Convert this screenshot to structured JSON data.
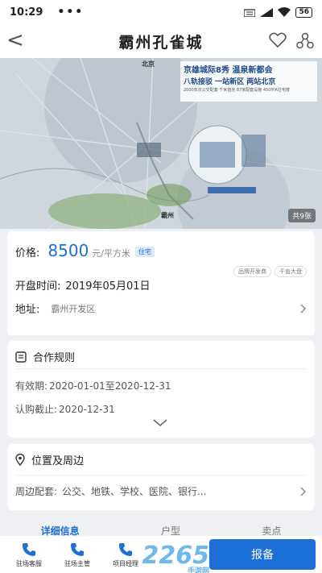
{
  "status_bar": {
    "time": "10:29",
    "dots": "•••",
    "battery": "56"
  },
  "nav": {
    "back": "<",
    "title": "霸州孔雀城"
  },
  "banner": {
    "ad_line1": "京雄城际8秀 温泉新都会",
    "ad_line2": "八轨接驳 一站新区 两站北京",
    "ad_line3": "2000年次公交配套  千米首店  87家配套设施  450平A住宅楼",
    "city_beijing": "北京",
    "city_bazhou": "霸州",
    "image_count": "共9张"
  },
  "price": {
    "label": "价格:",
    "value": "8500",
    "unit": "元/平方米",
    "type_tag": "住宅",
    "tags": [
      "品牌开发商",
      "千亩大盘"
    ]
  },
  "open": {
    "label": "开盘时间:",
    "value": "2019年05月01日"
  },
  "address": {
    "label": "地址:",
    "value": "霸州开发区"
  },
  "rules": {
    "title": "合作规则",
    "valid_label": "有效期:",
    "valid_value": "2020-01-01至2020-12-31",
    "deadline_label": "认购截止:",
    "deadline_value": "2020-12-31"
  },
  "location": {
    "title": "位置及周边",
    "facilities_label": "周边配套:",
    "facilities_value": "公交、地铁、学校、医院、银行..."
  },
  "tabs": [
    "详细信息",
    "户型",
    "卖点"
  ],
  "bottom": {
    "items": [
      "驻场客服",
      "驻场主管",
      "项目经理"
    ],
    "report": "报备"
  },
  "watermark": {
    "main": "2265",
    "sub": "手游网"
  },
  "colors": {
    "accent": "#1c6fd6"
  }
}
